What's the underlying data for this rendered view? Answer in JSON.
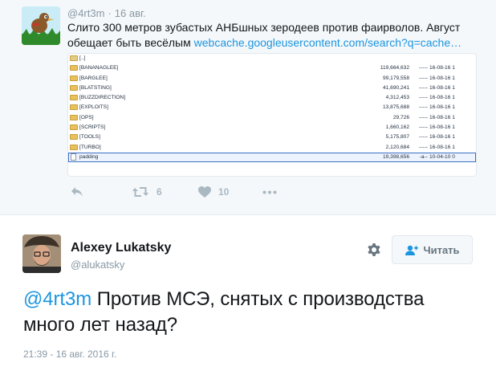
{
  "parent_tweet": {
    "handle": "@4rt3m",
    "separator": "·",
    "date": "16 авг.",
    "text": "Слито 300 метров зубастых АНБшных зеродеев против фаирволов. Август обещает быть весёлым ",
    "link": "webcache.googleusercontent.com/search?q=cache…",
    "media": {
      "files": [
        {
          "name": "[..]",
          "size": "",
          "attr": "",
          "date": "",
          "type": "up"
        },
        {
          "name": "[BANANAGLEE]",
          "size": "119,664,632",
          "attr": "-----",
          "date": "16-08-16 1",
          "type": "folder"
        },
        {
          "name": "[BARGLEE]",
          "size": "99,179,558",
          "attr": "-----",
          "date": "16-08-16 1",
          "type": "folder"
        },
        {
          "name": "[BLATSTING]",
          "size": "41,690,241",
          "attr": "-----",
          "date": "16-08-16 1",
          "type": "folder"
        },
        {
          "name": "[BUZZDIRECTION]",
          "size": "4,312,453",
          "attr": "-----",
          "date": "16-08-16 1",
          "type": "folder"
        },
        {
          "name": "[EXPLOITS]",
          "size": "13,875,688",
          "attr": "-----",
          "date": "16-08-16 1",
          "type": "folder"
        },
        {
          "name": "[OPS]",
          "size": "29,726",
          "attr": "-----",
          "date": "16-08-16 1",
          "type": "folder"
        },
        {
          "name": "[SCRIPTS]",
          "size": "1,660,162",
          "attr": "-----",
          "date": "16-08-16 1",
          "type": "folder"
        },
        {
          "name": "[TOOLS]",
          "size": "5,175,807",
          "attr": "-----",
          "date": "16-08-16 1",
          "type": "folder"
        },
        {
          "name": "[TURBO]",
          "size": "2,120,684",
          "attr": "-----",
          "date": "16-08-16 1",
          "type": "folder"
        },
        {
          "name": "padding",
          "size": "19,398,656",
          "attr": "-a--",
          "date": "10-04-10 0",
          "type": "file"
        }
      ]
    },
    "actions": {
      "reply_icon": "reply-icon",
      "retweet_icon": "retweet-icon",
      "retweet_count": "6",
      "like_icon": "heart-icon",
      "like_count": "10",
      "more_icon": "more-dots-icon"
    }
  },
  "main_tweet": {
    "name": "Alexey Lukatsky",
    "handle": "@alukatsky",
    "follow_label": "Читать",
    "mention": "@4rt3m",
    "text": " Против МСЭ, снятых с производства много лет назад?",
    "timestamp": "21:39 - 16 авг. 2016 г."
  },
  "colors": {
    "link": "#1b95e0",
    "muted": "#8899a6",
    "action_icon": "#aab8c2",
    "parent_bg": "#f5f8fa"
  }
}
